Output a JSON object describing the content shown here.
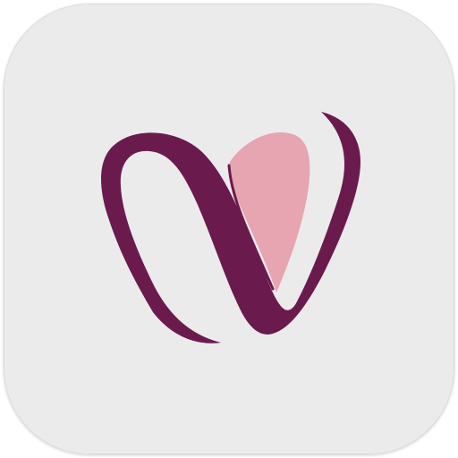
{
  "icon": {
    "name": "app-icon",
    "shape": "rounded-square",
    "glyph": "stylized-v-heart-logo"
  },
  "colors": {
    "tile_background": "#ECEBEC",
    "tile_border": "#D9D9D9",
    "logo_stroke": "#6B1A4E",
    "heart_fill": "#E7A4B1",
    "page_background": "#FFFFFF"
  }
}
